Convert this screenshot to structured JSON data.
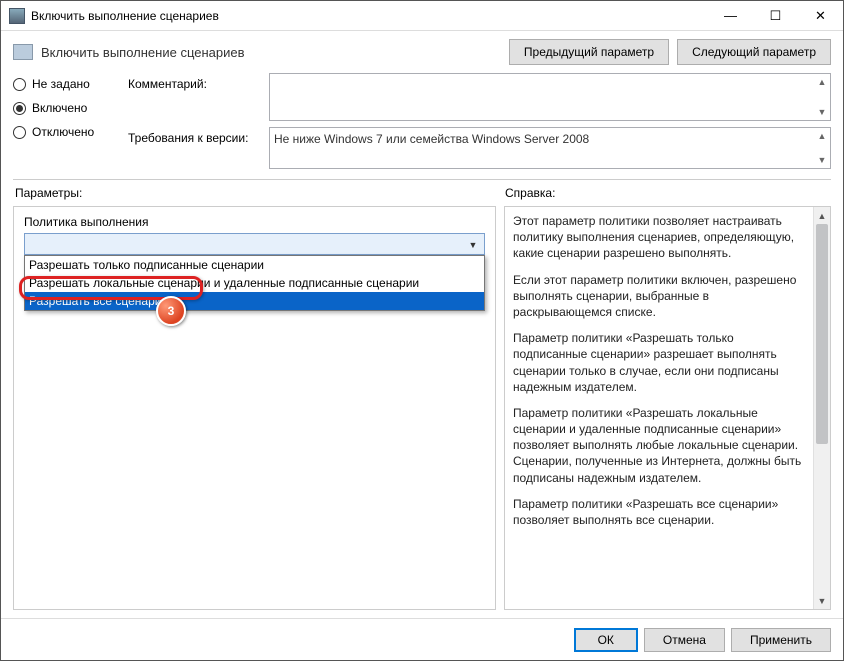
{
  "window": {
    "title": "Включить выполнение сценариев"
  },
  "header": {
    "heading": "Включить выполнение сценариев",
    "prev": "Предыдущий параметр",
    "next": "Следующий параметр"
  },
  "radios": {
    "not_configured": "Не задано",
    "enabled": "Включено",
    "disabled": "Отключено",
    "selected": "enabled"
  },
  "fields": {
    "comment_label": "Комментарий:",
    "comment_value": "",
    "supported_label": "Требования к версии:",
    "supported_value": "Не ниже Windows 7 или семейства Windows Server 2008"
  },
  "labels": {
    "options": "Параметры:",
    "help": "Справка:"
  },
  "dropdown": {
    "label": "Политика выполнения",
    "selected_value": "",
    "options": [
      "Разрешать только подписанные сценарии",
      "Разрешать локальные сценарии и удаленные подписанные сценарии",
      "Разрешать все сценарии"
    ],
    "highlighted_index": 2
  },
  "help": {
    "p1": "Этот параметр политики позволяет настраивать политику выполнения сценариев, определяющую, какие сценарии разрешено выполнять.",
    "p2": "Если этот параметр политики включен, разрешено выполнять сценарии, выбранные в раскрывающемся списке.",
    "p3": "Параметр политики «Разрешать только подписанные сценарии» разрешает выполнять сценарии только в случае, если они подписаны надежным издателем.",
    "p4": "Параметр политики «Разрешать локальные сценарии и удаленные подписанные сценарии» позволяет выполнять любые локальные сценарии. Сценарии, полученные из Интернета, должны быть подписаны надежным издателем.",
    "p5": "Параметр политики «Разрешать все сценарии» позволяет выполнять все сценарии."
  },
  "footer": {
    "ok": "ОК",
    "cancel": "Отмена",
    "apply": "Применить"
  },
  "annotation": {
    "step": "3"
  }
}
